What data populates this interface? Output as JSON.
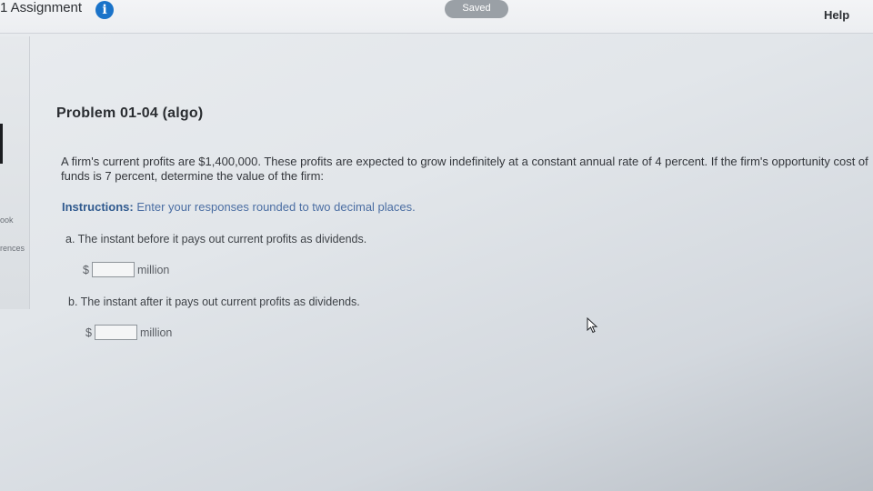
{
  "header": {
    "assignment_title": "1 Assignment",
    "info_icon": "info-icon",
    "saved_label": "Saved",
    "help_label": "Help"
  },
  "sidebar": {
    "items": [
      {
        "label": "ook"
      },
      {
        "label": "rences"
      }
    ]
  },
  "problem": {
    "title": "Problem 01-04 (algo)",
    "text": "A firm's current profits are $1,400,000. These profits are expected to grow indefinitely at a constant annual rate of 4 percent. If the firm's opportunity cost of funds is 7 percent, determine the value of the firm:",
    "instructions_label": "Instructions:",
    "instructions_text": " Enter your responses rounded to two decimal places.",
    "parts": [
      {
        "question": "a. The instant before it pays out current profits as dividends.",
        "currency": "$",
        "value": "",
        "unit": "million"
      },
      {
        "question": "b. The instant after it pays out current profits as dividends.",
        "currency": "$",
        "value": "",
        "unit": "million"
      }
    ]
  },
  "icons": {
    "cursor": "mouse-pointer-icon"
  },
  "colors": {
    "accent": "#1a73c9",
    "instructions": "#4b6ea3",
    "saved_pill": "#9aa0a6"
  }
}
